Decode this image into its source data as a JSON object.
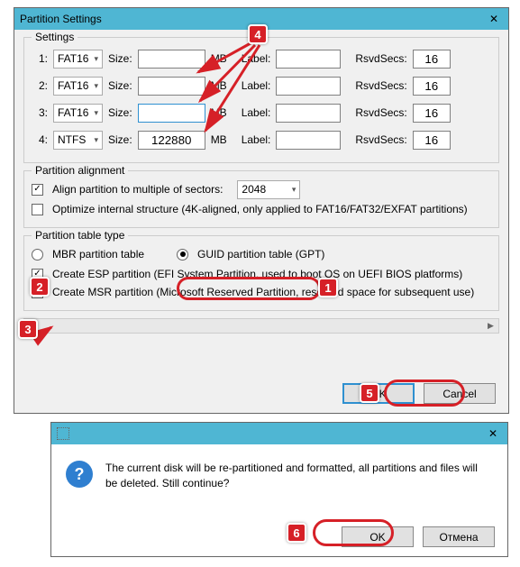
{
  "dialog1": {
    "title": "Partition Settings",
    "settings": {
      "legend": "Settings",
      "size_label": "Size:",
      "mb_label": "MB",
      "label_label": "Label:",
      "rsv_label": "RsvdSecs:",
      "rows": [
        {
          "idx": "1:",
          "fs": "FAT16",
          "size": "",
          "label": "",
          "rsv": "16"
        },
        {
          "idx": "2:",
          "fs": "FAT16",
          "size": "",
          "label": "",
          "rsv": "16"
        },
        {
          "idx": "3:",
          "fs": "FAT16",
          "size": "",
          "label": "",
          "rsv": "16"
        },
        {
          "idx": "4:",
          "fs": "NTFS",
          "size": "122880",
          "label": "",
          "rsv": "16"
        }
      ]
    },
    "align": {
      "legend": "Partition alignment",
      "align_label": "Align partition to multiple of sectors:",
      "align_value": "2048",
      "optimize_label": "Optimize internal structure (4K-aligned, only applied to FAT16/FAT32/EXFAT partitions)"
    },
    "ptt": {
      "legend": "Partition table type",
      "mbr_label": "MBR partition table",
      "gpt_label": "GUID partition table (GPT)",
      "esp_label": "Create ESP partition (EFI System Partition, used to boot OS on UEFI BIOS platforms)",
      "msr_label": "Create MSR partition (Microsoft Reserved Partition, reserved space for subsequent use)"
    },
    "buttons": {
      "ok": "OK",
      "cancel": "Cancel"
    }
  },
  "dialog2": {
    "message": "The current disk will be re-partitioned and formatted, all partitions and files will be deleted. Still continue?",
    "ok": "OK",
    "cancel": "Отмена"
  },
  "annotations": {
    "n1": "1",
    "n2": "2",
    "n3": "3",
    "n4": "4",
    "n5": "5",
    "n6": "6"
  }
}
